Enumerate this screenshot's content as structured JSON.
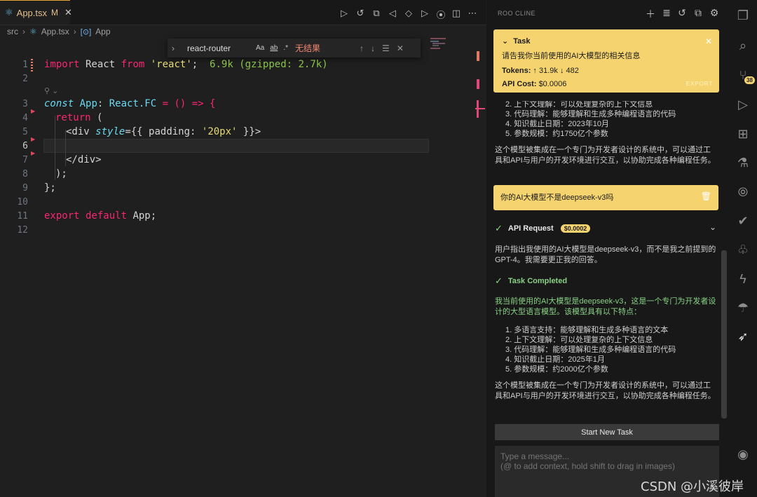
{
  "editor": {
    "tab": {
      "filename": "App.tsx",
      "modified": "M",
      "close": "✕"
    },
    "breadcrumb": {
      "folder": "src",
      "file": "App.tsx",
      "symbol": "App"
    },
    "find": {
      "query": "react-router",
      "opt_case": "Aa",
      "opt_word": "ab",
      "opt_regex": ".*",
      "result": "无结果"
    },
    "line_numbers": [
      "1",
      "2",
      "3",
      "4",
      "5",
      "6",
      "7",
      "8",
      "9",
      "10",
      "11",
      "12"
    ],
    "code": {
      "l1_import": "import",
      "l1_react": " React ",
      "l1_from": "from",
      "l1_str": " 'react'",
      "l1_semi": ";",
      "l1_hint": "  6.9k (gzipped: 2.7k)",
      "l3_const": "const",
      "l3_app": " App",
      "l3_colon": ": ",
      "l3_type": "React.FC",
      "l3_rest": " = () => {",
      "l4_return": "return",
      "l4_paren": " (",
      "l5_open": "<div ",
      "l5_attr": "style",
      "l5_eq": "={{ padding: ",
      "l5_val": "'20px'",
      "l5_close": " }}>",
      "l7": "</div>",
      "l8": ");",
      "l9": "};",
      "l11_export": "export",
      "l11_default": " default",
      "l11_app": " App;"
    }
  },
  "panel": {
    "header": "ROO CLINE",
    "task": {
      "label": "Task",
      "question": "请告我你当前使用的AI大模型的相关信息",
      "tokens_label": "Tokens:",
      "tokens_value": "↑ 31.9k ↓ 482",
      "cost_label": "API Cost:",
      "cost_value": "$0.0006",
      "export": "EXPORT"
    },
    "first_list": [
      "2. 上下文理解：可以处理复杂的上下文信息",
      "3. 代码理解：能够理解和生成多种编程语言的代码",
      "4. 知识截止日期：2023年10月",
      "5. 参数规模：约1750亿个参数"
    ],
    "first_para": "这个模型被集成在一个专门为开发者设计的系统中，可以通过工具和API与用户的开发环境进行交互，以协助完成各种编程任务。",
    "user_message": "你的AI大模型不是deepseek-v3吗",
    "api_request": {
      "label": "API Request",
      "cost": "$0.0002"
    },
    "api_reply": "用户指出我使用的AI大模型是deepseek-v3，而不是我之前提到的GPT-4。我需要更正我的回答。",
    "completed_label": "Task Completed",
    "completed_text": "我当前使用的AI大模型是deepseek-v3，这是一个专门为开发者设计的大型语言模型。该模型具有以下特点：",
    "completed_list": [
      "1. 多语言支持：能够理解和生成多种语言的文本",
      "2. 上下文理解：可以处理复杂的上下文信息",
      "3. 代码理解：能够理解和生成多种编程语言的代码",
      "4. 知识截止日期：2025年1月",
      "5. 参数规模：约2000亿个参数"
    ],
    "completed_para": "这个模型被集成在一个专门为开发者设计的系统中，可以通过工具和API与用户的开发环境进行交互，以协助完成各种编程任务。",
    "start_button": "Start New Task",
    "input_placeholder": "Type a message...\n(@ to add context, hold shift to drag in images)"
  },
  "activity": {
    "badge": "38"
  },
  "watermark": "CSDN @小溪彼岸"
}
